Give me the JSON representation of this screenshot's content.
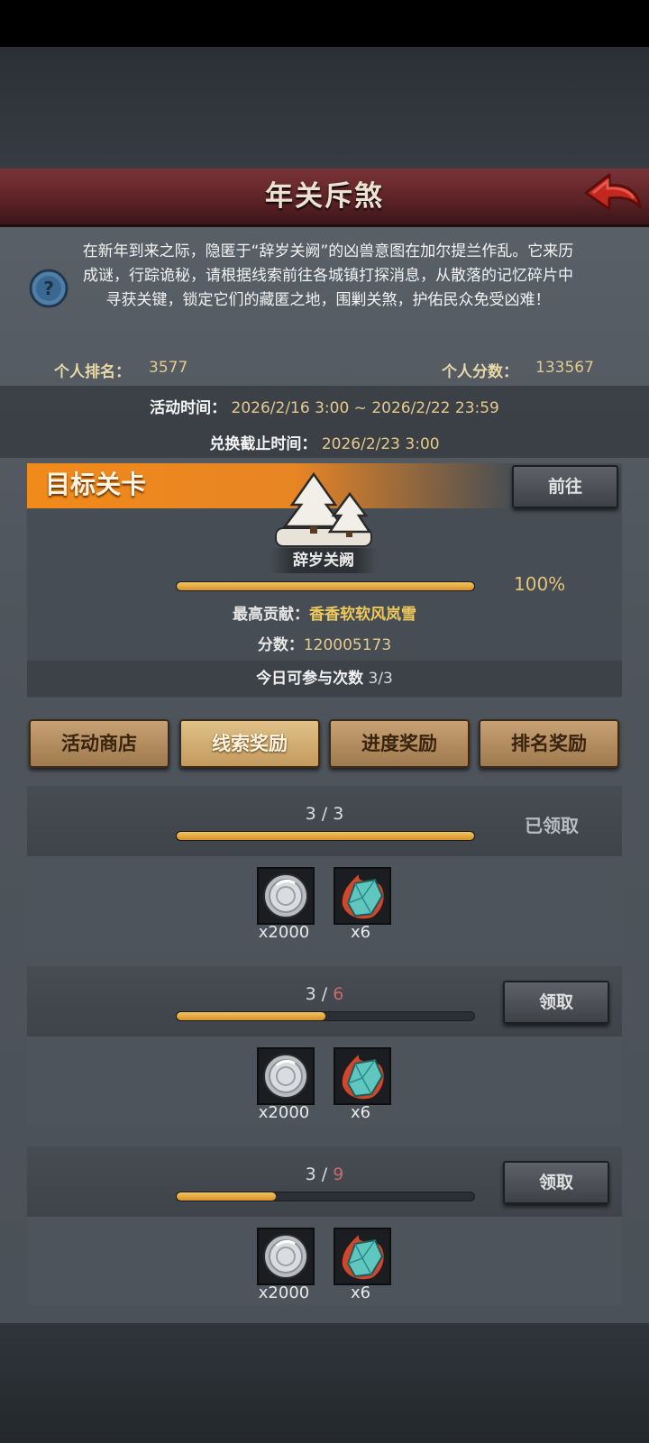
{
  "header": {
    "title": "年关斥煞"
  },
  "info": {
    "description": "在新年到来之际，隐匿于“辞岁关阙”的凶兽意图在加尔提兰作乱。它来历成谜，行踪诡秘，请根据线索前往各城镇打探消息，从散落的记忆碎片中寻获关键，锁定它们的藏匿之地，围剿关煞，护佑民众免受凶难！",
    "rank_label": "个人排名：",
    "rank_value": "3577",
    "score_label": "个人分数：",
    "score_value": "133567",
    "event_time_label": "活动时间：",
    "event_time_value": "2026/2/16 3:00 ~ 2026/2/22 23:59",
    "exchange_deadline_label": "兑换截止时间：",
    "exchange_deadline_value": "2026/2/23 3:00"
  },
  "target": {
    "tab_label": "目标关卡",
    "goto_label": "前往",
    "stage_name": "辞岁关阙",
    "progress": 1.0,
    "progress_text": "100%",
    "top_contrib_label": "最高贡献：",
    "top_contrib_value": "香香软软风岚雪",
    "score_label": "分数：",
    "score_value": "120005173",
    "attempts_label": "今日可参与次数",
    "attempts_value": "3/3"
  },
  "tabs": [
    {
      "label": "活动商店",
      "active": false
    },
    {
      "label": "线索奖励",
      "active": true
    },
    {
      "label": "进度奖励",
      "active": false
    },
    {
      "label": "排名奖励",
      "active": false
    }
  ],
  "rewards": [
    {
      "current": "3",
      "sep": " / ",
      "required": "3",
      "progress": 1.0,
      "status": "已领取",
      "items": [
        {
          "icon": "silver-coin-icon",
          "count": "x2000"
        },
        {
          "icon": "crystal-shard-icon",
          "count": "x6"
        }
      ]
    },
    {
      "current": "3",
      "sep": " / ",
      "required": "6",
      "progress": 0.5,
      "button": "领取",
      "items": [
        {
          "icon": "silver-coin-icon",
          "count": "x2000"
        },
        {
          "icon": "crystal-shard-icon",
          "count": "x6"
        }
      ]
    },
    {
      "current": "3",
      "sep": " / ",
      "required": "9",
      "progress": 0.333,
      "button": "领取",
      "items": [
        {
          "icon": "silver-coin-icon",
          "count": "x2000"
        },
        {
          "icon": "crystal-shard-icon",
          "count": "x6"
        }
      ]
    }
  ],
  "colors": {
    "accent_orange": "#f08a1a",
    "banner_red": "#6a2a2e",
    "bar_gold": "#e3a93c",
    "required_red": "#c66a6a"
  }
}
